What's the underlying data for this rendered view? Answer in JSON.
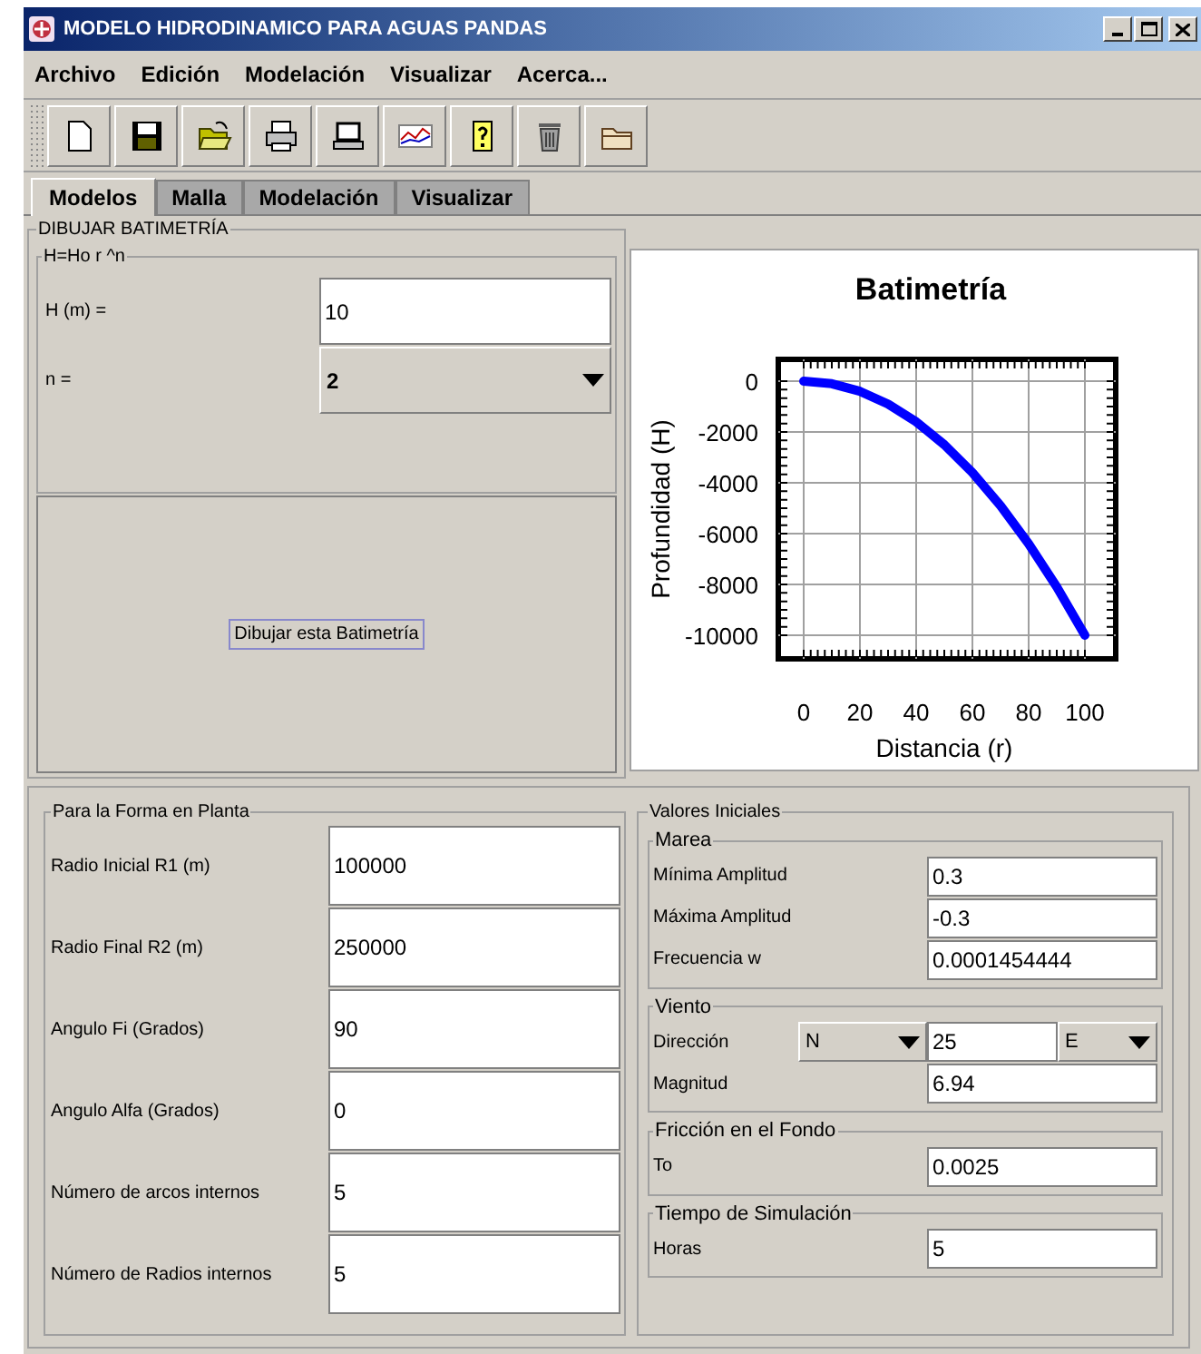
{
  "window": {
    "title": "MODELO HIDRODINAMICO PARA AGUAS PANDAS"
  },
  "menu": [
    "Archivo",
    "Edición",
    "Modelación",
    "Visualizar",
    "Acerca..."
  ],
  "tabs": [
    {
      "label": "Modelos",
      "selected": true
    },
    {
      "label": "Malla",
      "selected": false
    },
    {
      "label": "Modelación",
      "selected": false
    },
    {
      "label": "Visualizar",
      "selected": false
    }
  ],
  "batimetria": {
    "title": "DIBUJAR BATIMETRÍA",
    "formula": {
      "title": "H=Ho r ^n",
      "fields": [
        {
          "kind": "text",
          "label": "H (m) =",
          "value": "10"
        },
        {
          "kind": "dropdown",
          "label": "n =",
          "value": "2"
        }
      ]
    },
    "draw_button": "Dibujar esta Batimetría",
    "chart_data": {
      "type": "line",
      "title": "Batimetría",
      "xlabel": "Distancia (r)",
      "ylabel": "Profundidad (H)",
      "x": [
        0,
        10,
        20,
        30,
        40,
        50,
        60,
        70,
        80,
        90,
        100
      ],
      "series": [
        {
          "color": "#0000ff",
          "values": [
            0,
            -100,
            -400,
            -900,
            -1600,
            -2500,
            -3600,
            -4900,
            -6400,
            -8100,
            -10000
          ]
        }
      ],
      "xlim": [
        0,
        100
      ],
      "ylim": [
        -10000,
        0
      ],
      "xticks": [
        0,
        20,
        40,
        60,
        80,
        100
      ],
      "yticks": [
        0,
        -2000,
        -4000,
        -6000,
        -8000,
        -10000
      ],
      "grid": true
    }
  },
  "forma_en_planta": {
    "title": "Para la Forma en Planta",
    "fields": [
      {
        "label": "Radio Inicial R1 (m)",
        "value": "100000"
      },
      {
        "label": "Radio Final R2 (m)",
        "value": "250000"
      },
      {
        "label": "Angulo Fi (Grados)",
        "value": "90"
      },
      {
        "label": "Angulo Alfa (Grados)",
        "value": "0"
      },
      {
        "label": "Número de arcos internos",
        "value": "5"
      },
      {
        "label": "Número de Radios internos",
        "value": "5"
      }
    ]
  },
  "valores_iniciales": {
    "title": "Valores Iniciales",
    "groups": [
      {
        "title": "Marea",
        "rows": [
          {
            "kind": "text",
            "label": "Mínima Amplitud",
            "value": "0.3"
          },
          {
            "kind": "text",
            "label": "Máxima Amplitud",
            "value": "-0.3"
          },
          {
            "kind": "text",
            "label": "Frecuencia w",
            "value": "0.0001454444"
          }
        ]
      },
      {
        "title": "Viento",
        "rows": [
          {
            "kind": "direction",
            "label": "Dirección",
            "from": "N",
            "angle": "25",
            "to": "E"
          },
          {
            "kind": "text",
            "label": "Magnitud",
            "value": "6.94"
          }
        ]
      },
      {
        "title": "Fricción en el Fondo",
        "rows": [
          {
            "kind": "text",
            "label": "To",
            "value": "0.0025"
          }
        ]
      },
      {
        "title": "Tiempo de Simulación",
        "rows": [
          {
            "kind": "text",
            "label": "Horas",
            "value": "5"
          }
        ]
      }
    ]
  }
}
